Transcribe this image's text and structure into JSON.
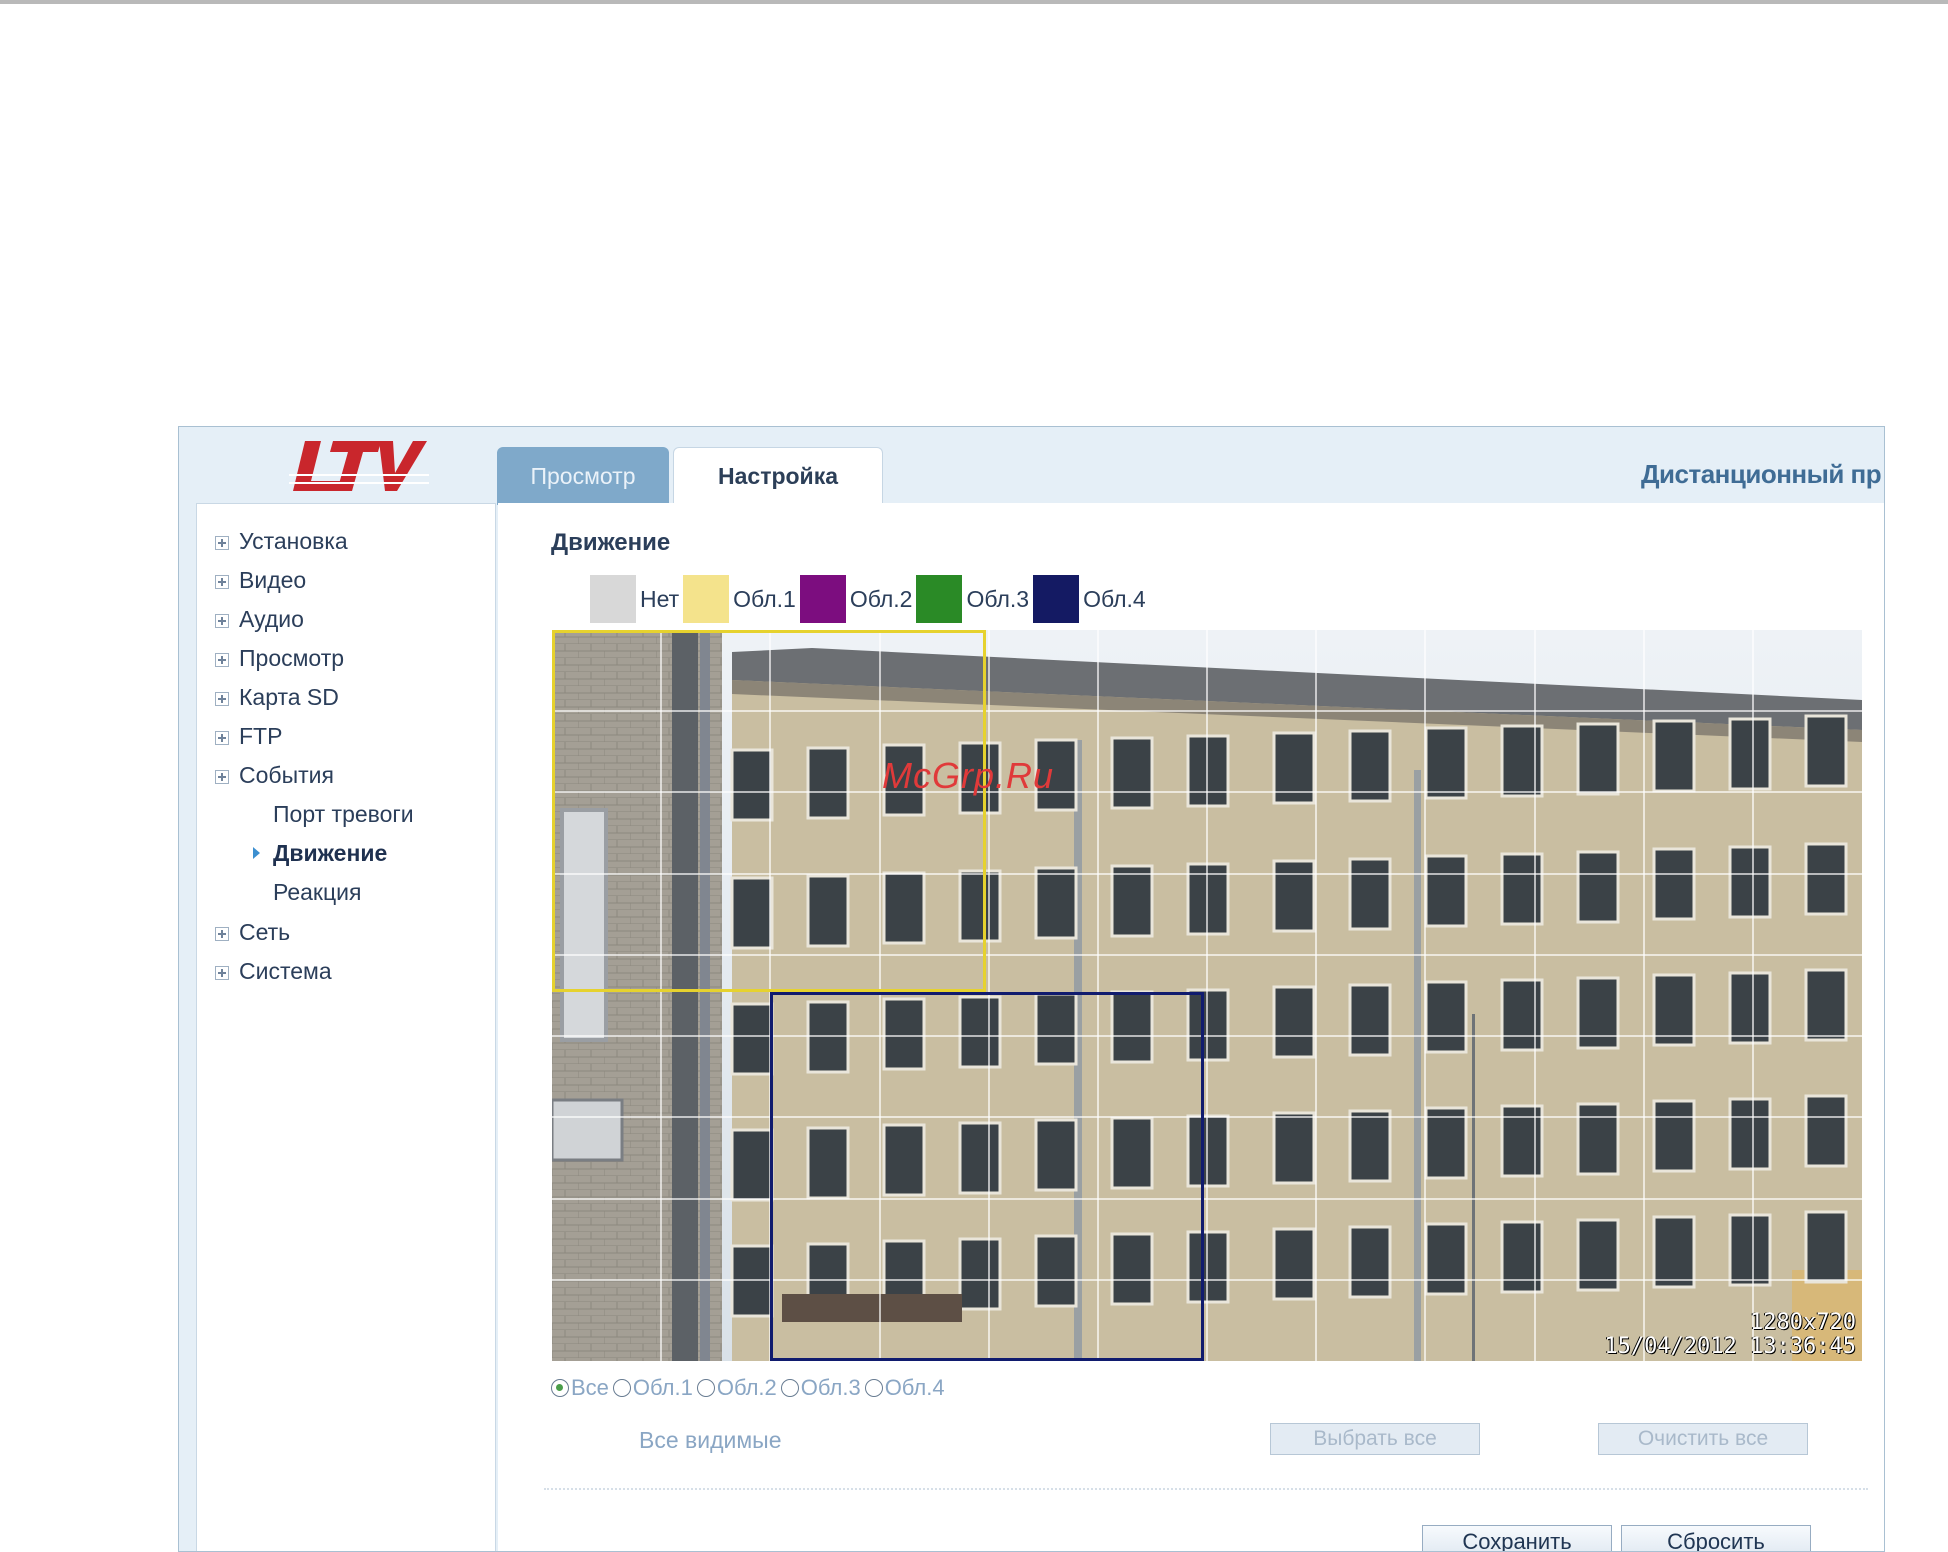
{
  "app": {
    "brand": "LTV",
    "title": "Дистанционный пр",
    "tabs": [
      {
        "label": "Просмотр",
        "active": false
      },
      {
        "label": "Настройка",
        "active": true
      }
    ]
  },
  "sidebar": {
    "items": [
      {
        "label": "Установка"
      },
      {
        "label": "Видео"
      },
      {
        "label": "Аудио"
      },
      {
        "label": "Просмотр"
      },
      {
        "label": "Карта SD"
      },
      {
        "label": "FTP"
      },
      {
        "label": "События"
      },
      {
        "label": "Сеть"
      },
      {
        "label": "Система"
      }
    ],
    "events_sub": [
      {
        "label": "Порт тревоги",
        "active": false
      },
      {
        "label": "Движение",
        "active": true
      },
      {
        "label": "Реакция",
        "active": false
      }
    ]
  },
  "motion": {
    "title": "Движение",
    "legend": [
      {
        "label": "Нет",
        "color": "#d8d8d8"
      },
      {
        "label": "Обл.1",
        "color": "#f4e38c"
      },
      {
        "label": "Обл.2",
        "color": "#7c0d7f"
      },
      {
        "label": "Обл.3",
        "color": "#2a8a26"
      },
      {
        "label": "Обл.4",
        "color": "#141a63"
      }
    ],
    "video": {
      "watermark": "McGrp.Ru",
      "resolution": "1280x720",
      "timestamp": "15/04/2012  13:36:45",
      "grid": {
        "columns": 12,
        "rows": 9
      }
    },
    "area_filter": {
      "options": [
        "Все",
        "Обл.1",
        "Обл.2",
        "Обл.3",
        "Обл.4"
      ],
      "selected": "Все"
    },
    "visible_label": "Все видимые",
    "select_all_label": "Выбрать все",
    "clear_all_label": "Очистить все",
    "save_label": "Сохранить",
    "reset_label": "Сбросить"
  }
}
